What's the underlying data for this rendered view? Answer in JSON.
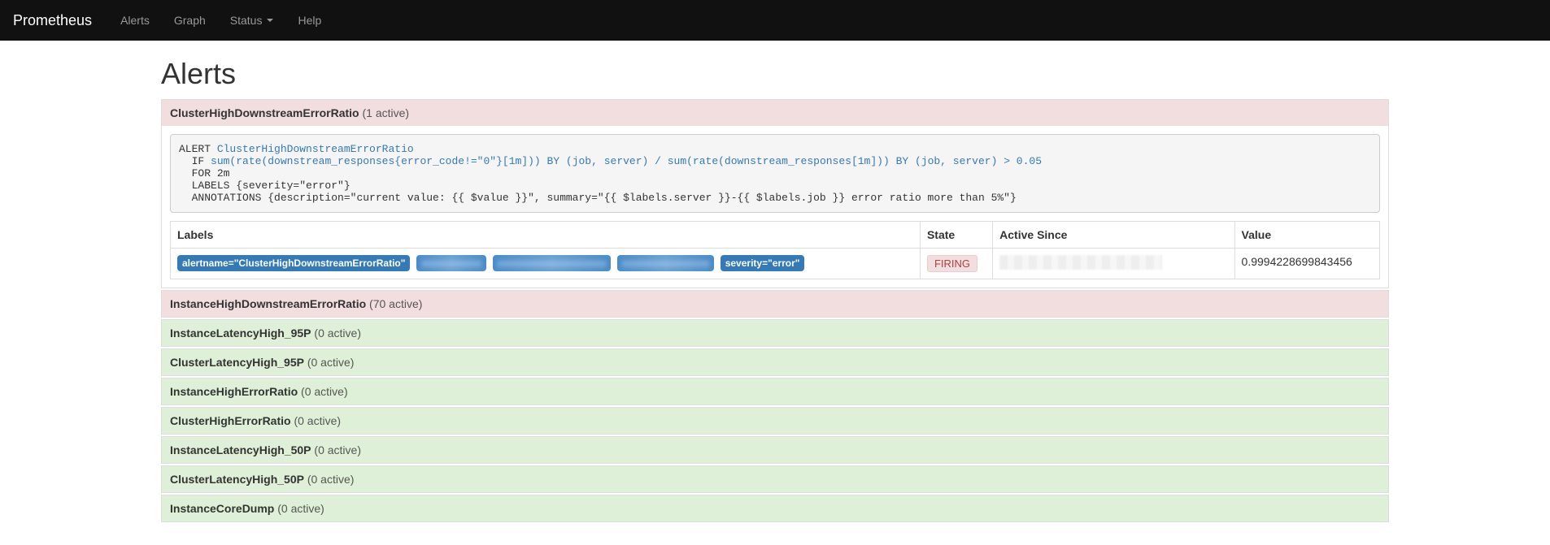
{
  "nav": {
    "brand": "Prometheus",
    "items": [
      "Alerts",
      "Graph",
      "Status",
      "Help"
    ],
    "status_has_caret": true
  },
  "page": {
    "title": "Alerts"
  },
  "expanded_alert": {
    "name": "ClusterHighDownstreamErrorRatio",
    "active_count_text": "(1 active)",
    "rule": {
      "keyword_alert": "ALERT",
      "alert_name": "ClusterHighDownstreamErrorRatio",
      "keyword_if": "IF",
      "expression": "sum(rate(downstream_responses{error_code!=\"0\"}[1m])) BY (job, server) / sum(rate(downstream_responses[1m])) BY (job, server) > 0.05",
      "for_line": "FOR 2m",
      "labels_line": "LABELS {severity=\"error\"}",
      "annotations_line": "ANNOTATIONS {description=\"current value: {{ $value }}\", summary=\"{{ $labels.server }}-{{ $labels.job }} error ratio more than 5%\"}"
    },
    "table": {
      "headers": {
        "labels": "Labels",
        "state": "State",
        "active_since": "Active Since",
        "value": "Value"
      },
      "row": {
        "visible_labels": {
          "first": "alertname=\"ClusterHighDownstreamErrorRatio\"",
          "last": "severity=\"error\""
        },
        "redacted_label_count": 3,
        "state": "FIRING",
        "active_since_redacted": true,
        "value": "0.9994228699843456"
      }
    }
  },
  "other_alerts": [
    {
      "name": "InstanceHighDownstreamErrorRatio",
      "count_text": "(70 active)",
      "variant": "pink"
    },
    {
      "name": "InstanceLatencyHigh_95P",
      "count_text": "(0 active)",
      "variant": "green"
    },
    {
      "name": "ClusterLatencyHigh_95P",
      "count_text": "(0 active)",
      "variant": "green"
    },
    {
      "name": "InstanceHighErrorRatio",
      "count_text": "(0 active)",
      "variant": "green"
    },
    {
      "name": "ClusterHighErrorRatio",
      "count_text": "(0 active)",
      "variant": "green"
    },
    {
      "name": "InstanceLatencyHigh_50P",
      "count_text": "(0 active)",
      "variant": "green"
    },
    {
      "name": "ClusterLatencyHigh_50P",
      "count_text": "(0 active)",
      "variant": "green"
    },
    {
      "name": "InstanceCoreDump",
      "count_text": "(0 active)",
      "variant": "green"
    }
  ]
}
